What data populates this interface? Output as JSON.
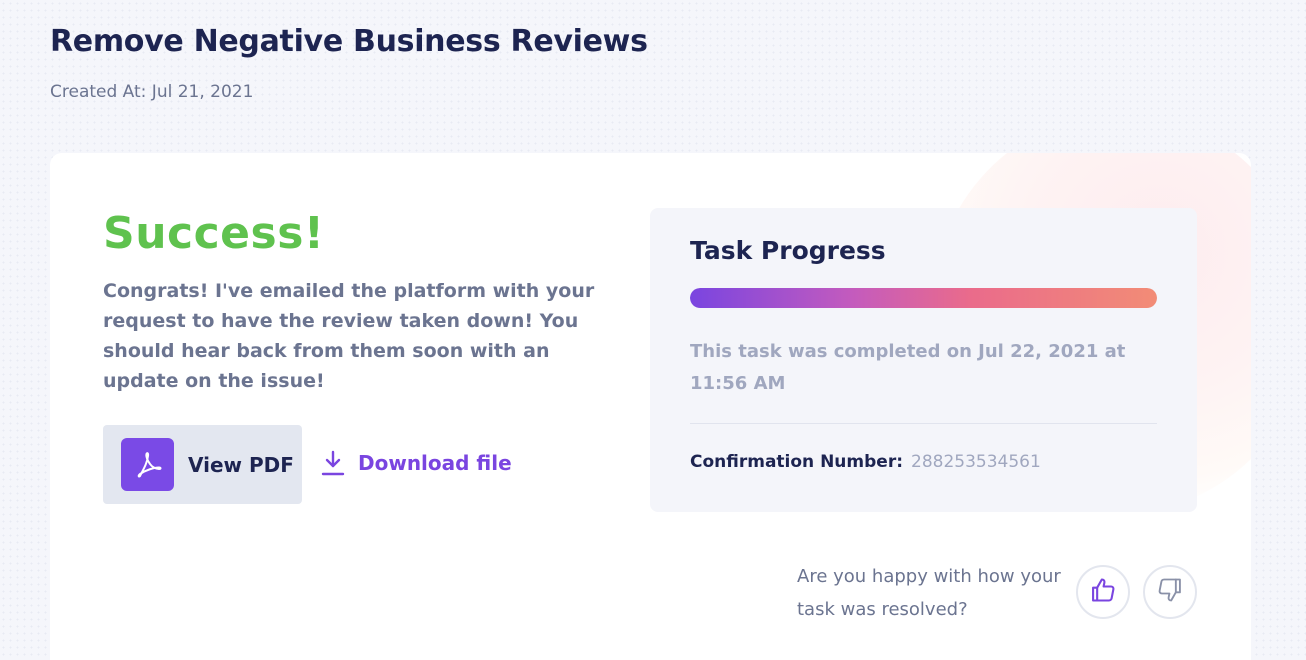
{
  "header": {
    "title": "Remove Negative Business Reviews",
    "created_at": "Created At: Jul 21, 2021"
  },
  "result": {
    "title": "Success!",
    "message": "Congrats! I've emailed the platform with your request to have the review taken down! You should hear back from them soon with an update on the issue!",
    "view_pdf_label": "View PDF",
    "download_label": "Download file"
  },
  "progress": {
    "title": "Task Progress",
    "percent": 100,
    "completed_text": "This task was completed on Jul 22, 2021 at 11:56 AM",
    "confirmation_label": "Confirmation Number:",
    "confirmation_value": "288253534561"
  },
  "feedback": {
    "question": "Are you happy with how your task was resolved?",
    "thumb_up_icon": "thumbs-up-icon",
    "thumb_down_icon": "thumbs-down-icon"
  },
  "colors": {
    "success": "#5fc24e",
    "accent": "#7a45e0",
    "heading": "#1d2451",
    "muted": "#6b7490"
  }
}
